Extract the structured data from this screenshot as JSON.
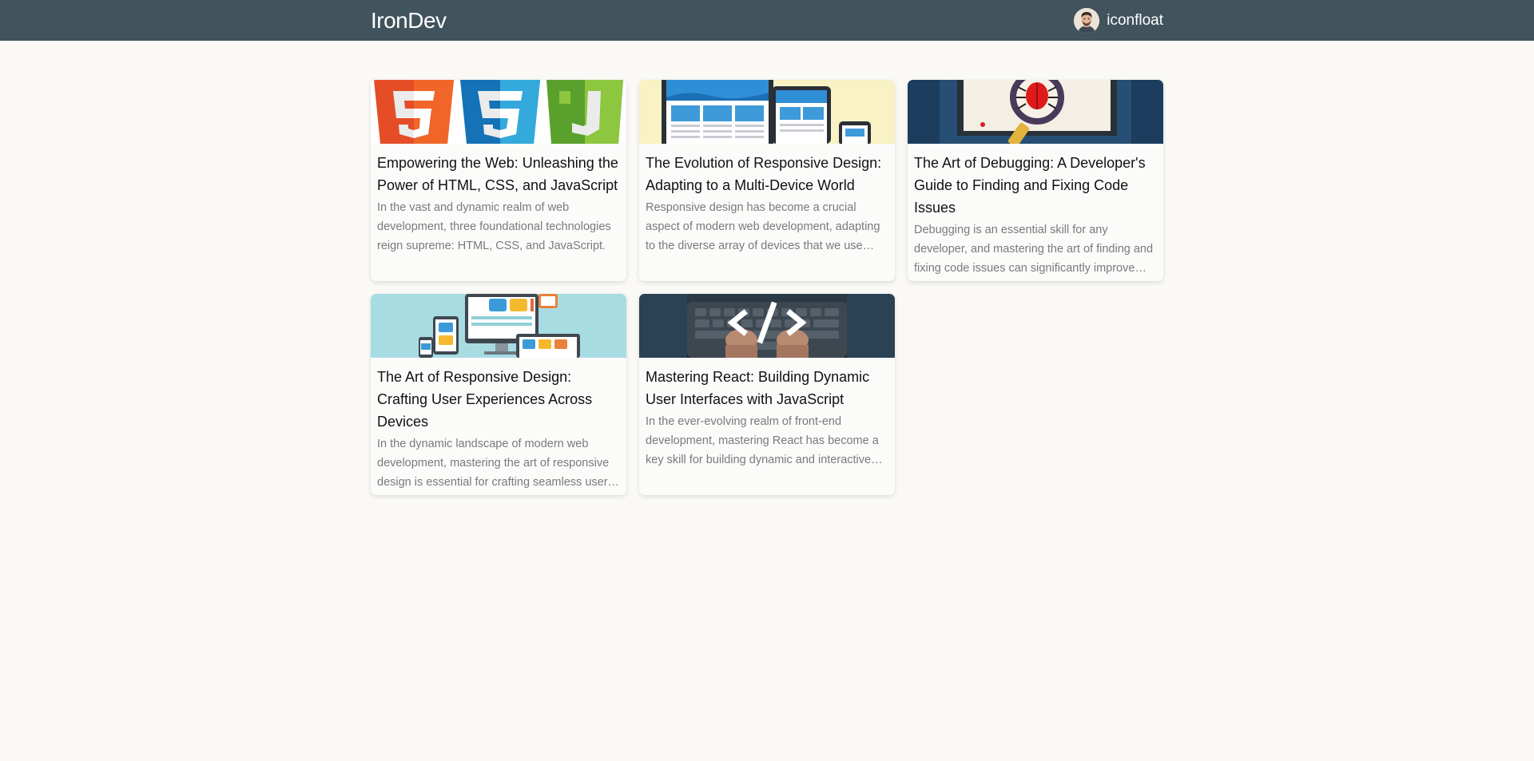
{
  "header": {
    "logo": "IronDev",
    "username": "iconfloat",
    "background_color": "#41535c",
    "avatar_icon": "user-avatar"
  },
  "posts": [
    {
      "title": "Empowering the Web: Unleashing the Power of HTML, CSS, and JavaScript",
      "excerpt": "In the vast and dynamic realm of web development, three foundational technologies reign supreme: HTML, CSS, and JavaScript.",
      "image": "html-css-js-logos"
    },
    {
      "title": "The Evolution of Responsive Design: Adapting to a Multi-Device World",
      "excerpt": "Responsive design has become a crucial aspect of modern web development, adapting to the diverse array of devices that we use every day.",
      "image": "responsive-devices-illustration"
    },
    {
      "title": "The Art of Debugging: A Developer's Guide to Finding and Fixing Code Issues",
      "excerpt": "Debugging is an essential skill for any developer, and mastering the art of finding and fixing code issues can significantly improve your work.",
      "image": "bug-magnifier-illustration"
    },
    {
      "title": "The Art of Responsive Design: Crafting User Experiences Across Devices",
      "excerpt": "In the dynamic landscape of modern web development, mastering the art of responsive design is essential for crafting seamless user experiences.",
      "image": "multi-device-illustration"
    },
    {
      "title": "Mastering React: Building Dynamic User Interfaces with JavaScript",
      "excerpt": "In the ever-evolving realm of front-end development, mastering React has become a key skill for building dynamic and interactive user interfaces.",
      "image": "code-keyboard-photo"
    }
  ]
}
